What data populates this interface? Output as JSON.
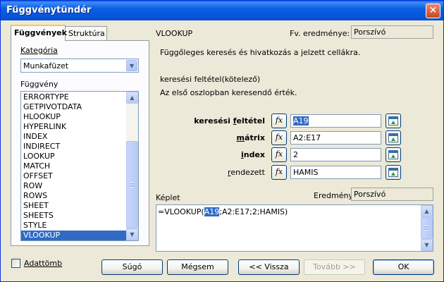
{
  "window": {
    "title": "Függvénytündér",
    "close_glyph": "✕"
  },
  "tabs": [
    {
      "label": "Függvények",
      "active": true
    },
    {
      "label": "Struktúra",
      "active": false
    }
  ],
  "category": {
    "label": "Kategória",
    "selected": "Munkafüzet"
  },
  "function_list": {
    "label": "Függvény",
    "items": [
      "ERRORTYPE",
      "GETPIVOTDATA",
      "HLOOKUP",
      "HYPERLINK",
      "INDEX",
      "INDIRECT",
      "LOOKUP",
      "MATCH",
      "OFFSET",
      "ROW",
      "ROWS",
      "SHEET",
      "SHEETS",
      "STYLE",
      "VLOOKUP"
    ],
    "selected": "VLOOKUP",
    "scroll_position": 0.92
  },
  "function": {
    "name": "VLOOKUP",
    "result_label": "Fv. eredménye:",
    "result_value": "Porszívó",
    "description": "Függőleges keresés és hivatkozás a jelzett cellákra.",
    "arg_title": "keresési feltétel(kötelező)",
    "arg_description": "Az első oszlopban keresendő érték."
  },
  "arguments": [
    {
      "label": "keresési feltétel",
      "underline": "f",
      "bold": true,
      "value": "A19",
      "selected": true
    },
    {
      "label": "mátrix",
      "underline": "m",
      "bold": true,
      "value": "A2:E17",
      "selected": false
    },
    {
      "label": "index",
      "underline": "i",
      "bold": true,
      "value": "2",
      "selected": false
    },
    {
      "label": "rendezett",
      "underline": "r",
      "bold": false,
      "value": "HAMIS",
      "selected": false
    }
  ],
  "fx_glyph": "fx",
  "formula": {
    "label": "Képlet",
    "result_label": "Eredmény",
    "result_value": "Porszívó",
    "before": "=VLOOKUP(",
    "highlight": "A19",
    "after": ";A2:E17;2;HAMIS)"
  },
  "checkbox": {
    "label": "Adattömb",
    "checked": false
  },
  "buttons": {
    "help": "Súgó",
    "cancel": "Mégsem",
    "back": "<< Vissza",
    "next": "Tovább >>",
    "ok": "OK"
  },
  "icons": [
    "close-icon",
    "chevron-down-icon",
    "fx-icon",
    "shrink-icon",
    "scroll-up-icon",
    "scroll-down-icon"
  ]
}
